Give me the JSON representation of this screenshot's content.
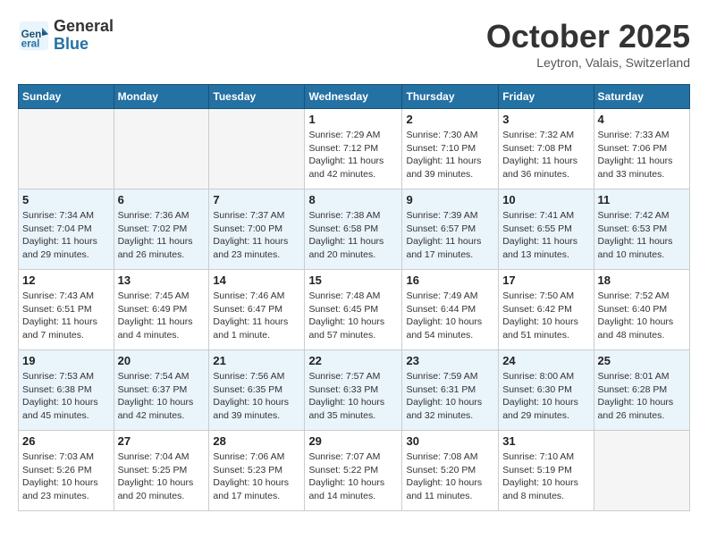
{
  "header": {
    "logo_line1": "General",
    "logo_line2": "Blue",
    "month": "October 2025",
    "location": "Leytron, Valais, Switzerland"
  },
  "weekdays": [
    "Sunday",
    "Monday",
    "Tuesday",
    "Wednesday",
    "Thursday",
    "Friday",
    "Saturday"
  ],
  "weeks": [
    [
      {
        "day": "",
        "info": ""
      },
      {
        "day": "",
        "info": ""
      },
      {
        "day": "",
        "info": ""
      },
      {
        "day": "1",
        "info": "Sunrise: 7:29 AM\nSunset: 7:12 PM\nDaylight: 11 hours and 42 minutes."
      },
      {
        "day": "2",
        "info": "Sunrise: 7:30 AM\nSunset: 7:10 PM\nDaylight: 11 hours and 39 minutes."
      },
      {
        "day": "3",
        "info": "Sunrise: 7:32 AM\nSunset: 7:08 PM\nDaylight: 11 hours and 36 minutes."
      },
      {
        "day": "4",
        "info": "Sunrise: 7:33 AM\nSunset: 7:06 PM\nDaylight: 11 hours and 33 minutes."
      }
    ],
    [
      {
        "day": "5",
        "info": "Sunrise: 7:34 AM\nSunset: 7:04 PM\nDaylight: 11 hours and 29 minutes."
      },
      {
        "day": "6",
        "info": "Sunrise: 7:36 AM\nSunset: 7:02 PM\nDaylight: 11 hours and 26 minutes."
      },
      {
        "day": "7",
        "info": "Sunrise: 7:37 AM\nSunset: 7:00 PM\nDaylight: 11 hours and 23 minutes."
      },
      {
        "day": "8",
        "info": "Sunrise: 7:38 AM\nSunset: 6:58 PM\nDaylight: 11 hours and 20 minutes."
      },
      {
        "day": "9",
        "info": "Sunrise: 7:39 AM\nSunset: 6:57 PM\nDaylight: 11 hours and 17 minutes."
      },
      {
        "day": "10",
        "info": "Sunrise: 7:41 AM\nSunset: 6:55 PM\nDaylight: 11 hours and 13 minutes."
      },
      {
        "day": "11",
        "info": "Sunrise: 7:42 AM\nSunset: 6:53 PM\nDaylight: 11 hours and 10 minutes."
      }
    ],
    [
      {
        "day": "12",
        "info": "Sunrise: 7:43 AM\nSunset: 6:51 PM\nDaylight: 11 hours and 7 minutes."
      },
      {
        "day": "13",
        "info": "Sunrise: 7:45 AM\nSunset: 6:49 PM\nDaylight: 11 hours and 4 minutes."
      },
      {
        "day": "14",
        "info": "Sunrise: 7:46 AM\nSunset: 6:47 PM\nDaylight: 11 hours and 1 minute."
      },
      {
        "day": "15",
        "info": "Sunrise: 7:48 AM\nSunset: 6:45 PM\nDaylight: 10 hours and 57 minutes."
      },
      {
        "day": "16",
        "info": "Sunrise: 7:49 AM\nSunset: 6:44 PM\nDaylight: 10 hours and 54 minutes."
      },
      {
        "day": "17",
        "info": "Sunrise: 7:50 AM\nSunset: 6:42 PM\nDaylight: 10 hours and 51 minutes."
      },
      {
        "day": "18",
        "info": "Sunrise: 7:52 AM\nSunset: 6:40 PM\nDaylight: 10 hours and 48 minutes."
      }
    ],
    [
      {
        "day": "19",
        "info": "Sunrise: 7:53 AM\nSunset: 6:38 PM\nDaylight: 10 hours and 45 minutes."
      },
      {
        "day": "20",
        "info": "Sunrise: 7:54 AM\nSunset: 6:37 PM\nDaylight: 10 hours and 42 minutes."
      },
      {
        "day": "21",
        "info": "Sunrise: 7:56 AM\nSunset: 6:35 PM\nDaylight: 10 hours and 39 minutes."
      },
      {
        "day": "22",
        "info": "Sunrise: 7:57 AM\nSunset: 6:33 PM\nDaylight: 10 hours and 35 minutes."
      },
      {
        "day": "23",
        "info": "Sunrise: 7:59 AM\nSunset: 6:31 PM\nDaylight: 10 hours and 32 minutes."
      },
      {
        "day": "24",
        "info": "Sunrise: 8:00 AM\nSunset: 6:30 PM\nDaylight: 10 hours and 29 minutes."
      },
      {
        "day": "25",
        "info": "Sunrise: 8:01 AM\nSunset: 6:28 PM\nDaylight: 10 hours and 26 minutes."
      }
    ],
    [
      {
        "day": "26",
        "info": "Sunrise: 7:03 AM\nSunset: 5:26 PM\nDaylight: 10 hours and 23 minutes."
      },
      {
        "day": "27",
        "info": "Sunrise: 7:04 AM\nSunset: 5:25 PM\nDaylight: 10 hours and 20 minutes."
      },
      {
        "day": "28",
        "info": "Sunrise: 7:06 AM\nSunset: 5:23 PM\nDaylight: 10 hours and 17 minutes."
      },
      {
        "day": "29",
        "info": "Sunrise: 7:07 AM\nSunset: 5:22 PM\nDaylight: 10 hours and 14 minutes."
      },
      {
        "day": "30",
        "info": "Sunrise: 7:08 AM\nSunset: 5:20 PM\nDaylight: 10 hours and 11 minutes."
      },
      {
        "day": "31",
        "info": "Sunrise: 7:10 AM\nSunset: 5:19 PM\nDaylight: 10 hours and 8 minutes."
      },
      {
        "day": "",
        "info": ""
      }
    ]
  ]
}
